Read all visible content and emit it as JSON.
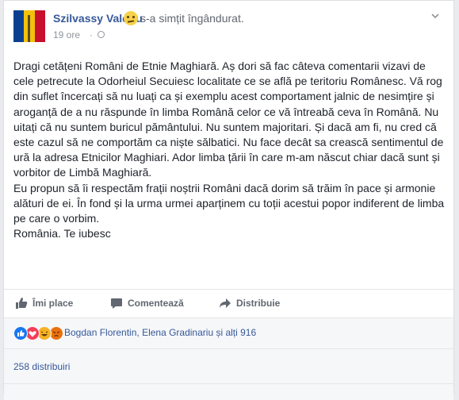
{
  "post": {
    "author": "Szilvassy Valeriu",
    "feeling": "s-a simțit îngândurat.",
    "time": "19 ore",
    "dot": "·",
    "paragraphs": [
      "Dragi cetățeni Români de Etnie Maghiară. Aș dori să fac câteva comentarii vizavi de cele petrecute la Odorheiul Secuiesc localitate ce se află pe teritoriu Românesc. Vă rog din suflet încercați să nu luați ca și exemplu acest comportament jalnic de nesimțire și aroganță de a nu răspunde în limba Română celor ce vă întreabă ceva în Română. Nu uitați că nu suntem buricul pământului. Nu suntem majoritari. Și dacă am fi, nu cred că este cazul să ne comportăm ca niște sălbatici. Nu face decât sa crească sentimentul de ură la adresa Etnicilor Maghiari. Ador limba țării în care m-am născut chiar dacă sunt și vorbitor de Limbă Maghiară.",
      "Eu propun să îi respectăm frații noștrii Români dacă dorim să trăim în pace și armonie alături de ei. În fond și la urma urmei aparținem cu toții acestui popor indiferent de limba pe care o vorbim.",
      "România. Te iubesc"
    ]
  },
  "actions": {
    "like": "Îmi place",
    "comment": "Comentează",
    "share": "Distribuie"
  },
  "reactions": {
    "names": "Bogdan Florentin, Elena Gradinariu și alți 916",
    "types": [
      "like-icon",
      "love-icon",
      "haha-icon",
      "angry-icon"
    ]
  },
  "shares": "258 distribuiri",
  "colors": {
    "link": "#365899",
    "like": "#1877f2",
    "love": "#f33e58",
    "haha": "#f7b125",
    "angry": "#e9710f"
  }
}
